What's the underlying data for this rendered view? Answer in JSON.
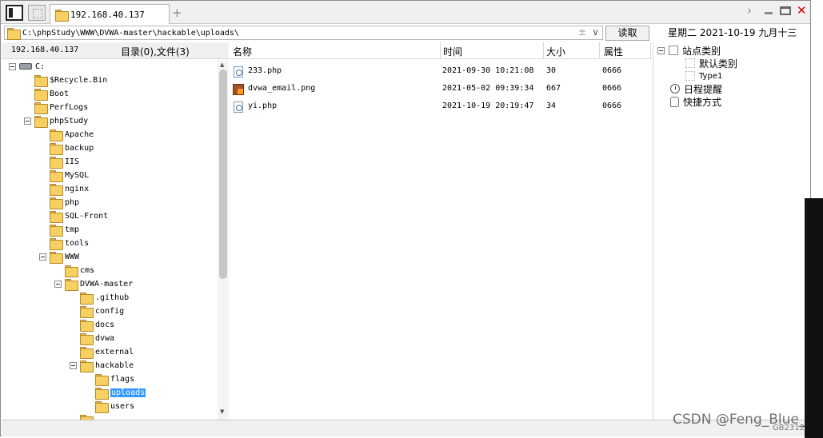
{
  "tabs": {
    "active_label": "192.168.40.137",
    "add_label": "+"
  },
  "address": {
    "path": "C:\\phpStudy\\WWW\\DVWA-master\\hackable\\uploads\\",
    "favorite_glyph": "±",
    "dropdown_glyph": "∨",
    "read_label": "读取"
  },
  "date": "星期二  2021-10-19  九月十三",
  "left_pane": {
    "host": "192.168.40.137",
    "dir_count": "目录(0),文件(3)"
  },
  "tree": [
    {
      "label": "C:",
      "level": 0,
      "expanded": true,
      "drive": true
    },
    {
      "label": "$Recycle.Bin",
      "level": 1
    },
    {
      "label": "Boot",
      "level": 1
    },
    {
      "label": "PerfLogs",
      "level": 1
    },
    {
      "label": "phpStudy",
      "level": 1,
      "expanded": true
    },
    {
      "label": "Apache",
      "level": 2
    },
    {
      "label": "backup",
      "level": 2
    },
    {
      "label": "IIS",
      "level": 2
    },
    {
      "label": "MySQL",
      "level": 2
    },
    {
      "label": "nginx",
      "level": 2
    },
    {
      "label": "php",
      "level": 2
    },
    {
      "label": "SQL-Front",
      "level": 2
    },
    {
      "label": "tmp",
      "level": 2
    },
    {
      "label": "tools",
      "level": 2
    },
    {
      "label": "WWW",
      "level": 2,
      "expanded": true
    },
    {
      "label": "cms",
      "level": 3
    },
    {
      "label": "DVWA-master",
      "level": 3,
      "expanded": true
    },
    {
      "label": ".github",
      "level": 4
    },
    {
      "label": "config",
      "level": 4
    },
    {
      "label": "docs",
      "level": 4
    },
    {
      "label": "dvwa",
      "level": 4
    },
    {
      "label": "external",
      "level": 4
    },
    {
      "label": "hackable",
      "level": 4,
      "expanded": true
    },
    {
      "label": "flags",
      "level": 5
    },
    {
      "label": "uploads",
      "level": 5,
      "selected": true
    },
    {
      "label": "users",
      "level": 5
    },
    {
      "label": "",
      "level": 4
    }
  ],
  "files": {
    "columns": [
      "名称",
      "时间",
      "大小",
      "属性"
    ],
    "rows": [
      {
        "name": "233.php",
        "time": "2021-09-30 10:21:08",
        "size": "30",
        "attr": "0666",
        "icon": "php-file-icon"
      },
      {
        "name": "dvwa_email.png",
        "time": "2021-05-02 09:39:34",
        "size": "667",
        "attr": "0666",
        "icon": "image-file-icon"
      },
      {
        "name": "yi.php",
        "time": "2021-10-19 20:19:47",
        "size": "34",
        "attr": "0666",
        "icon": "php-file-icon"
      }
    ]
  },
  "right_panel": {
    "site_category": "站点类别",
    "default_category": "默认类别",
    "type1": "Type1",
    "schedule": "日程提醒",
    "shortcuts": "快捷方式"
  },
  "status_text": "GB2312",
  "watermark": "CSDN @Feng_Blue_",
  "colors": {
    "selection": "#3399ff",
    "folder": "#f7d062",
    "close": "#d00000"
  }
}
